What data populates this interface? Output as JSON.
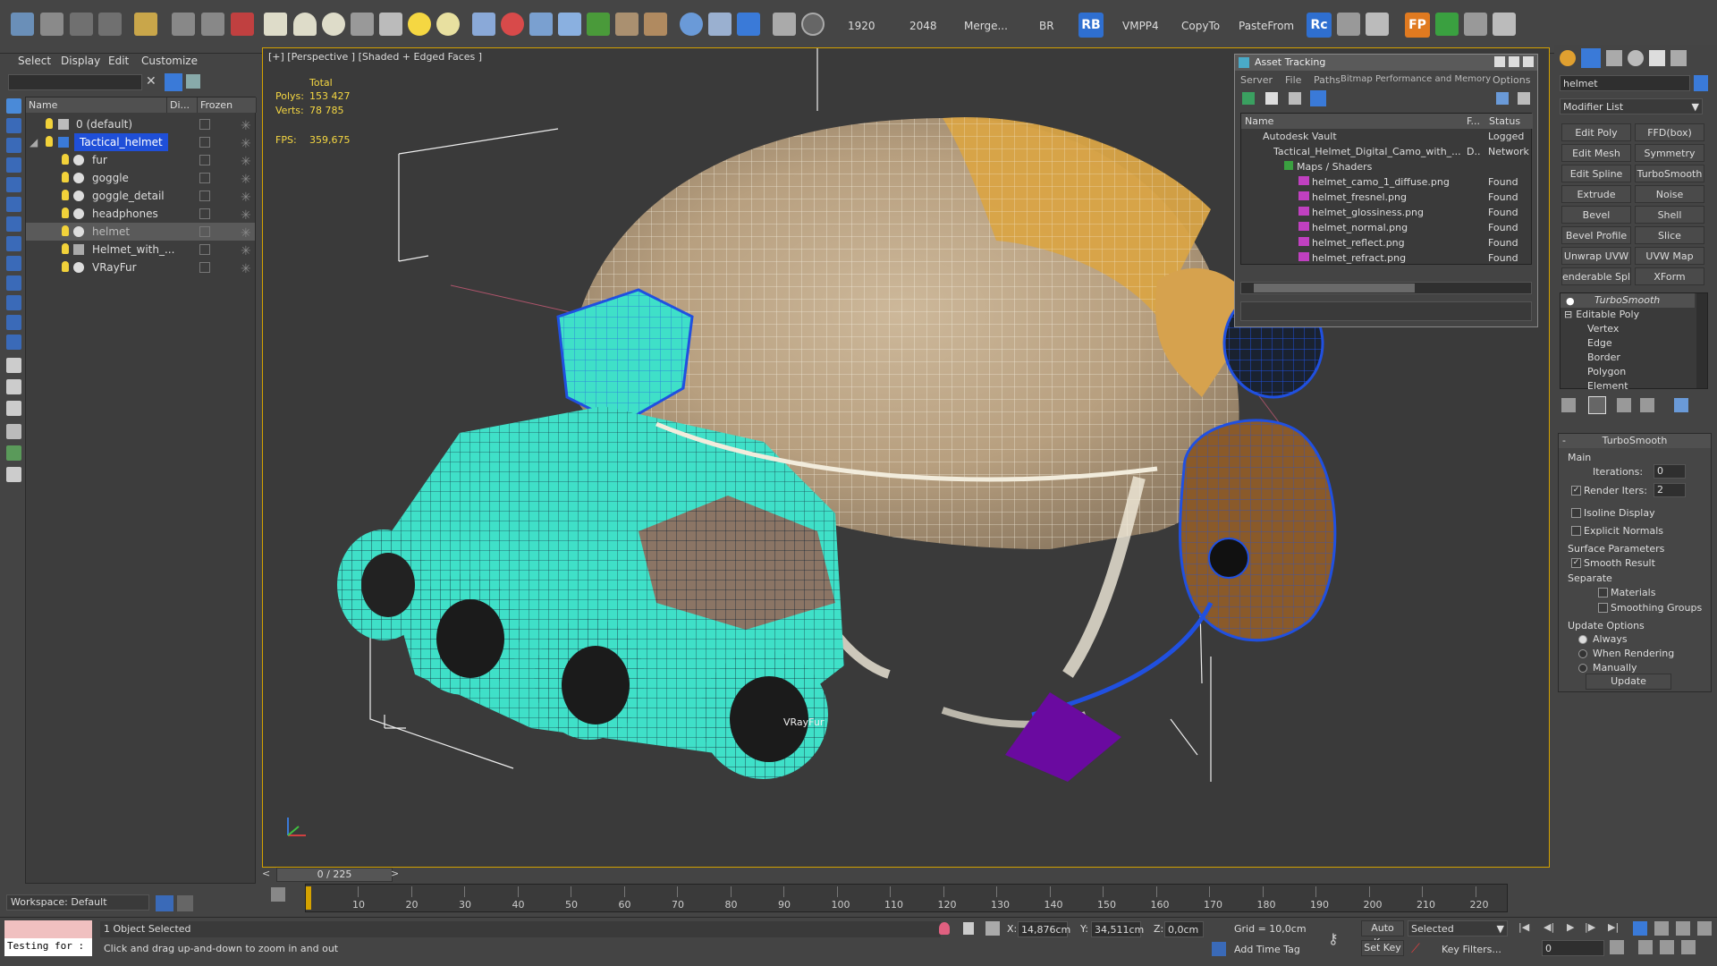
{
  "toolbar": {
    "res1": "1920",
    "res2": "2048",
    "merge": "Merge...",
    "br": "BR",
    "rb": "RB",
    "vmpp4": "VMPP4",
    "copyto": "CopyTo",
    "pastefrom": "PasteFrom",
    "rc": "Rc",
    "fp": "FP"
  },
  "scene_explorer": {
    "menus": [
      "Select",
      "Display",
      "Edit",
      "Customize"
    ],
    "columns": {
      "name": "Name",
      "display": "Di...",
      "frozen": "Frozen"
    },
    "rows": [
      {
        "name": "0 (default)"
      },
      {
        "name": "Tactical_helmet"
      },
      {
        "name": "fur"
      },
      {
        "name": "goggle"
      },
      {
        "name": "goggle_detail"
      },
      {
        "name": "headphones"
      },
      {
        "name": "helmet"
      },
      {
        "name": "Helmet_with_..."
      },
      {
        "name": "VRayFur"
      }
    ],
    "workspace": "Workspace: Default"
  },
  "viewport": {
    "label": "[+] [Perspective ] [Shaded + Edged Faces ]",
    "stats": {
      "total_label": "Total",
      "polys_label": "Polys:",
      "polys_value": "153 427",
      "verts_label": "Verts:",
      "verts_value": "78 785",
      "fps_label": "FPS:",
      "fps_value": "359,675"
    },
    "object_label": "VRayFur"
  },
  "asset_tracking": {
    "title": "Asset Tracking",
    "menus": [
      "Server",
      "File",
      "Paths",
      "Bitmap Performance and Memory",
      "Options"
    ],
    "columns": {
      "name": "Name",
      "f": "F...",
      "status": "Status"
    },
    "rows": [
      {
        "name": "Autodesk Vault",
        "f": "",
        "status": "Logged Ou"
      },
      {
        "name": "Tactical_Helmet_Digital_Camo_with_...",
        "f": "D..",
        "status": "Network P"
      },
      {
        "name": "Maps / Shaders",
        "f": "",
        "status": ""
      },
      {
        "name": "helmet_camo_1_diffuse.png",
        "f": "",
        "status": "Found"
      },
      {
        "name": "helmet_fresnel.png",
        "f": "",
        "status": "Found"
      },
      {
        "name": "helmet_glossiness.png",
        "f": "",
        "status": "Found"
      },
      {
        "name": "helmet_normal.png",
        "f": "",
        "status": "Found"
      },
      {
        "name": "helmet_reflect.png",
        "f": "",
        "status": "Found"
      },
      {
        "name": "helmet_refract.png",
        "f": "",
        "status": "Found"
      }
    ]
  },
  "command_panel": {
    "object_name": "helmet",
    "modifier_list": "Modifier List",
    "modifier_buttons": [
      "Edit Poly",
      "FFD(box)",
      "Edit Mesh",
      "Symmetry",
      "Edit Spline",
      "TurboSmooth",
      "Extrude",
      "Noise",
      "Bevel",
      "Shell",
      "Bevel Profile",
      "Slice",
      "Unwrap UVW",
      "UVW Map",
      "enderable Splin",
      "XForm"
    ],
    "stack": [
      "TurboSmooth",
      "Editable Poly",
      "Vertex",
      "Edge",
      "Border",
      "Polygon",
      "Element"
    ],
    "rollout_title": "TurboSmooth",
    "main_label": "Main",
    "iterations_label": "Iterations:",
    "iterations_value": "0",
    "render_iters_label": "Render Iters:",
    "render_iters_value": "2",
    "isoline": "Isoline Display",
    "explicit": "Explicit Normals",
    "surface_params": "Surface Parameters",
    "smooth_result": "Smooth Result",
    "separate": "Separate",
    "materials": "Materials",
    "smoothing_groups": "Smoothing Groups",
    "update_options": "Update Options",
    "always": "Always",
    "when_rendering": "When Rendering",
    "manually": "Manually",
    "update_btn": "Update"
  },
  "timeline": {
    "frame": "0 / 225",
    "ticks": [
      "10",
      "20",
      "30",
      "40",
      "50",
      "60",
      "70",
      "80",
      "90",
      "100",
      "110",
      "120",
      "130",
      "140",
      "150",
      "160",
      "170",
      "180",
      "190",
      "200",
      "210",
      "220"
    ]
  },
  "status": {
    "maxscript": "Testing for :",
    "selected": "1 Object Selected",
    "prompt": "Click and drag up-and-down to zoom in and out",
    "x_label": "X:",
    "x_value": "14,876cm",
    "y_label": "Y:",
    "y_value": "34,511cm",
    "z_label": "Z:",
    "z_value": "0,0cm",
    "grid": "Grid = 10,0cm",
    "add_time_tag": "Add Time Tag",
    "auto_key": "Auto Key",
    "set_key": "Set Key",
    "selected_dropdown": "Selected",
    "key_filters": "Key Filters...",
    "frame_value": "0"
  },
  "colors": {
    "viewport_border": "#d4a200",
    "selection_blue": "#1f4fd8",
    "goggle_cyan": "#3fe0c8"
  }
}
